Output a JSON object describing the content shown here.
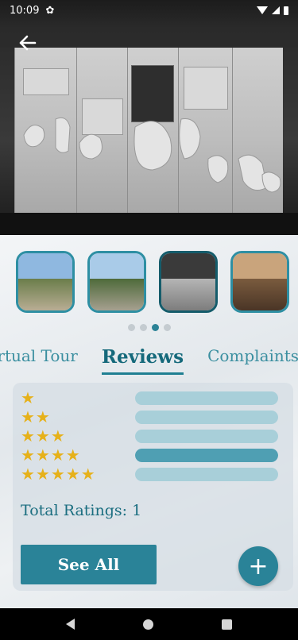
{
  "status_bar": {
    "time": "10:09"
  },
  "colors": {
    "accent": "#2a8398",
    "star": "#e6b11a",
    "bar_track": "#a8cfd9",
    "bar_fill": "#4f9fb3"
  },
  "icons": {
    "back": "back-arrow-icon",
    "settings": "gear-icon",
    "wifi": "wifi-icon",
    "signal": "signal-icon",
    "battery": "battery-icon",
    "add": "plus-icon"
  },
  "gallery": {
    "count": 4,
    "active_index": 2
  },
  "pager": {
    "pages": 4,
    "active": 2
  },
  "tabs": [
    {
      "label": "irtual Tour",
      "active": false
    },
    {
      "label": "Reviews",
      "active": true
    },
    {
      "label": "Complaints",
      "active": false
    }
  ],
  "ratings": [
    {
      "stars": "★",
      "fraction": 0
    },
    {
      "stars": "★★",
      "fraction": 0
    },
    {
      "stars": "★★★",
      "fraction": 0
    },
    {
      "stars": "★★★★",
      "fraction": 1
    },
    {
      "stars": "★★★★★",
      "fraction": 0
    }
  ],
  "total_ratings": "Total Ratings: 1",
  "see_all_label": "See All",
  "fab_label": "+"
}
